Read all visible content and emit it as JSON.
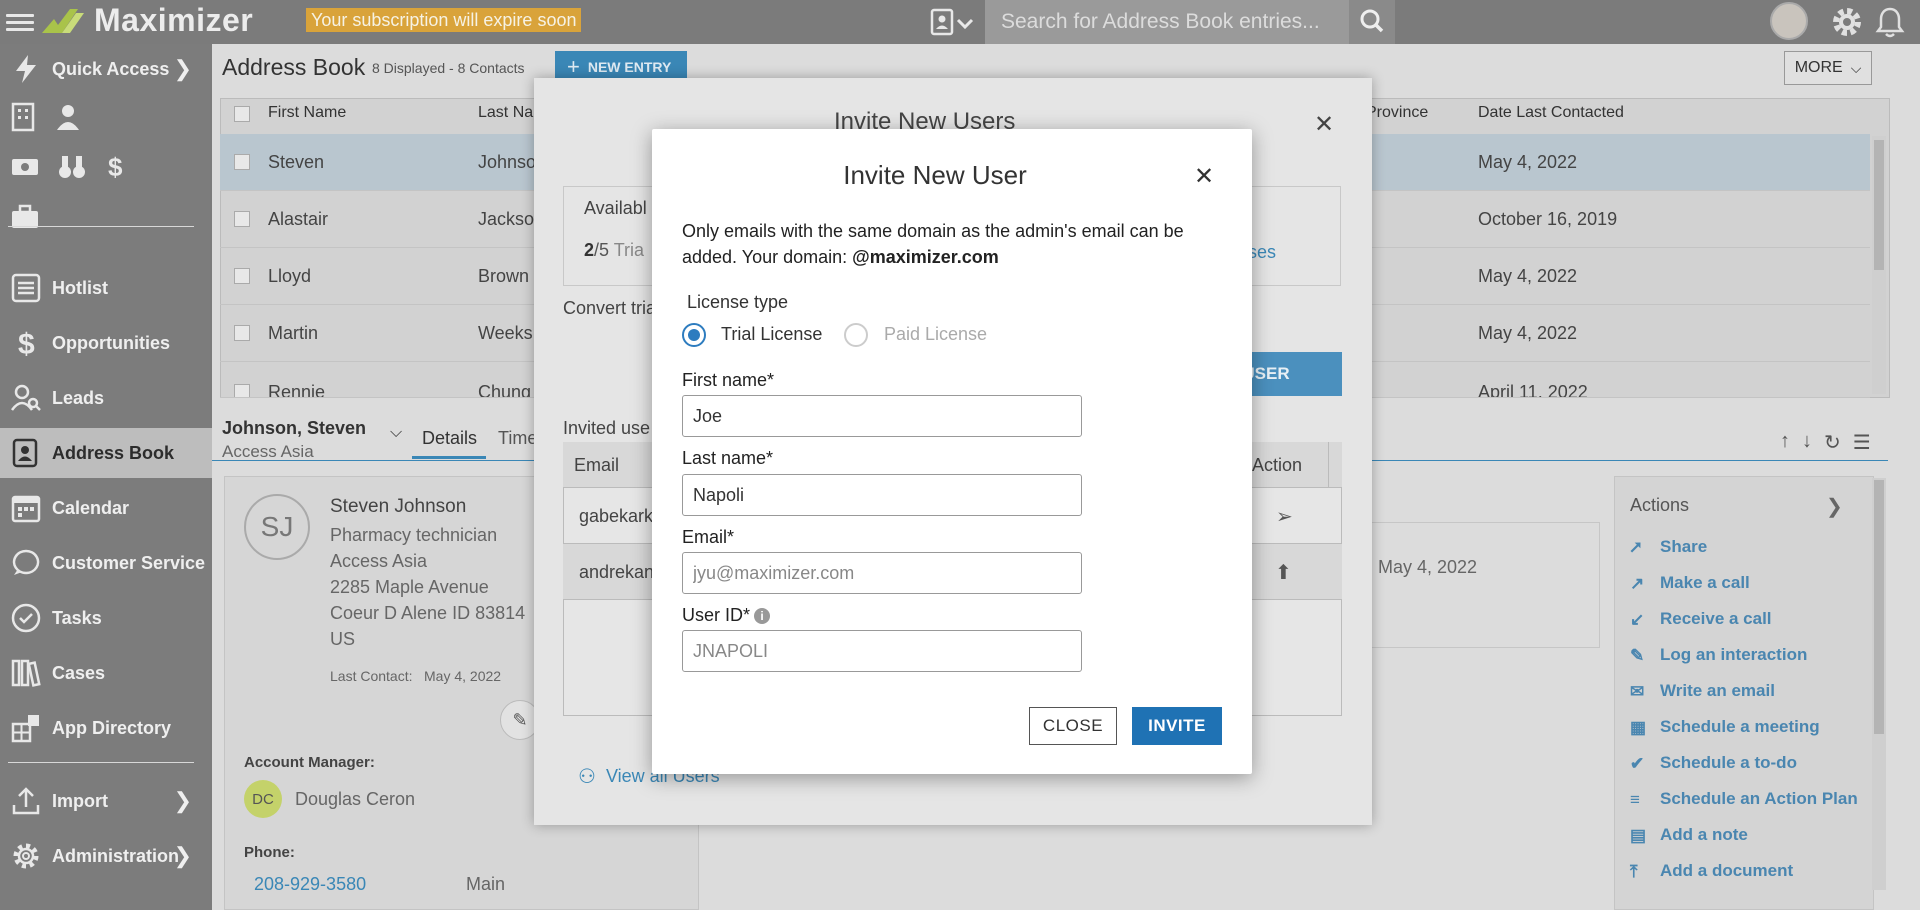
{
  "topbar": {
    "app_name": "Maximizer",
    "subscription_warning": "Your subscription will expire soon",
    "search_placeholder": "Search for Address Book entries..."
  },
  "sidebar": {
    "quick_access": "Quick Access",
    "items": [
      {
        "label": "Hotlist",
        "icon": "hotlist-icon"
      },
      {
        "label": "Opportunities",
        "icon": "dollar-icon"
      },
      {
        "label": "Leads",
        "icon": "leads-icon"
      },
      {
        "label": "Address Book",
        "icon": "address-book-icon",
        "active": true
      },
      {
        "label": "Calendar",
        "icon": "calendar-icon"
      },
      {
        "label": "Customer Service",
        "icon": "customer-service-icon"
      },
      {
        "label": "Tasks",
        "icon": "tasks-icon"
      },
      {
        "label": "Cases",
        "icon": "cases-icon"
      },
      {
        "label": "App Directory",
        "icon": "app-directory-icon"
      }
    ],
    "import": "Import",
    "administration": "Administration"
  },
  "address_book": {
    "title": "Address Book",
    "count": "8 Displayed - 8 Contacts",
    "new_entry": "NEW ENTRY",
    "more": "MORE",
    "columns": [
      "First Name",
      "Last Na",
      "Province",
      "Date Last Contacted"
    ],
    "rows": [
      {
        "first": "Steven",
        "last": "Johnso",
        "date": "May 4, 2022"
      },
      {
        "first": "Alastair",
        "last": "Jackso",
        "date": "October 16, 2019"
      },
      {
        "first": "Lloyd",
        "last": "Brown",
        "date": "May 4, 2022"
      },
      {
        "first": "Martin",
        "last": "Weeks",
        "date": "May 4, 2022"
      },
      {
        "first": "Rennie",
        "last": "Chung",
        "date": "April 11, 2022"
      }
    ]
  },
  "detail": {
    "header_name": "Johnson, Steven",
    "header_company": "Access Asia",
    "tab_details": "Details",
    "tab_time": "Time",
    "initials": "SJ",
    "name": "Steven Johnson",
    "job": "Pharmacy technician",
    "company": "Access Asia",
    "address1": "2285 Maple Avenue",
    "address2": "Coeur D Alene ID 83814",
    "country": "US",
    "last_contact_label": "Last Contact:",
    "last_contact_value": "May 4, 2022",
    "account_manager_label": "Account Manager:",
    "account_manager_initials": "DC",
    "account_manager": "Douglas Ceron",
    "phone_label": "Phone:",
    "phone": "208-929-3580",
    "phone_type": "Main",
    "timeline_date": "May 4, 2022"
  },
  "actions": {
    "title": "Actions",
    "items": [
      "Share",
      "Make a call",
      "Receive a call",
      "Log an interaction",
      "Write an email",
      "Schedule a meeting",
      "Schedule a to-do",
      "Schedule an Action Plan",
      "Add a note",
      "Add a document"
    ]
  },
  "invite_users_modal": {
    "title": "Invite New Users",
    "available_label": "Availabl",
    "count_main": "2",
    "count_rest": "/5",
    "count_suffix": "Tria",
    "licenses_link": "enses",
    "convert_text": "Convert tria",
    "add_user_button": "USER",
    "invited_label": "Invited use",
    "col_email": "Email",
    "col_action": "Action",
    "rows": [
      "gabekark",
      "andrekan"
    ],
    "view_all": "View all Users"
  },
  "invite_user_modal": {
    "title": "Invite New User",
    "description": "Only emails with the same domain as the admin's email can be added. Your domain: ",
    "domain": "@maximizer.com",
    "license_type_label": "License type",
    "trial_label": "Trial License",
    "paid_label": "Paid License",
    "first_name_label": "First name*",
    "first_name_value": "Joe",
    "last_name_label": "Last name*",
    "last_name_value": "Napoli",
    "email_label": "Email*",
    "email_placeholder": "jyu@maximizer.com",
    "user_id_label": "User ID*",
    "user_id_placeholder": "JNAPOLI",
    "close_button": "CLOSE",
    "invite_button": "INVITE"
  },
  "colors": {
    "accent": "#1f72b4",
    "sidebar_bg": "#7c7c7c",
    "link": "#3a87b6",
    "warning": "#d9a33a"
  }
}
